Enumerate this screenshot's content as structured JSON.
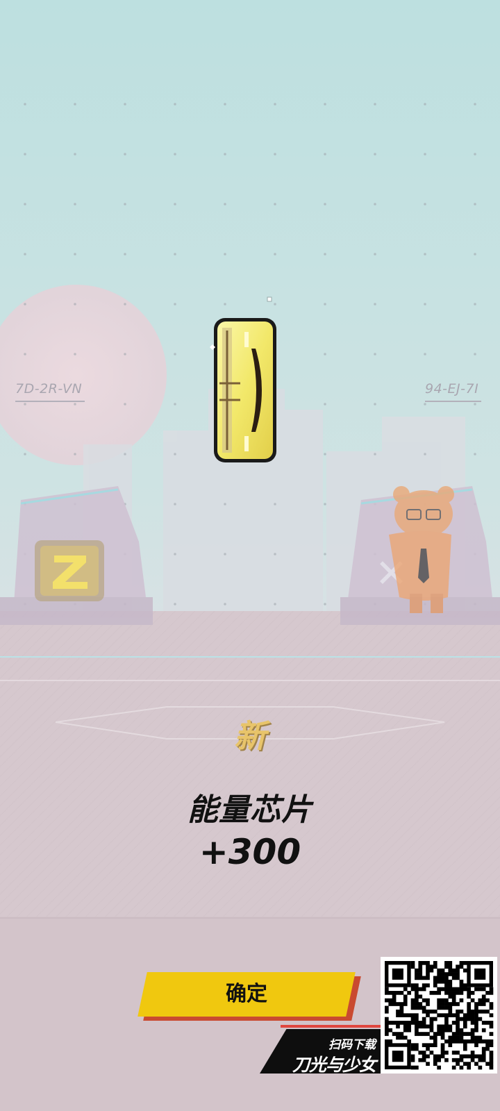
{
  "scene": {
    "left_station_code": "7D-2R-VN",
    "right_station_code": "94-EJ-7I",
    "left_tile_icon": "z-letter-icon",
    "right_tile_icon": "x-mark-icon"
  },
  "reward": {
    "item_icon": "energy-chip-icon",
    "new_badge": "新",
    "name": "能量芯片",
    "amount": "+300"
  },
  "actions": {
    "confirm_label": "确定"
  },
  "promo": {
    "scan_text": "扫码下载",
    "app_title": "刀光与少女",
    "qr_icon": "qr-code-icon"
  },
  "colors": {
    "sky": "#bfe1e1",
    "floor": "#d7c9cf",
    "button": "#f0c80f",
    "button_shadow": "#c94a30",
    "badge": "#e8c46a",
    "chip": "#f6ee7d"
  }
}
